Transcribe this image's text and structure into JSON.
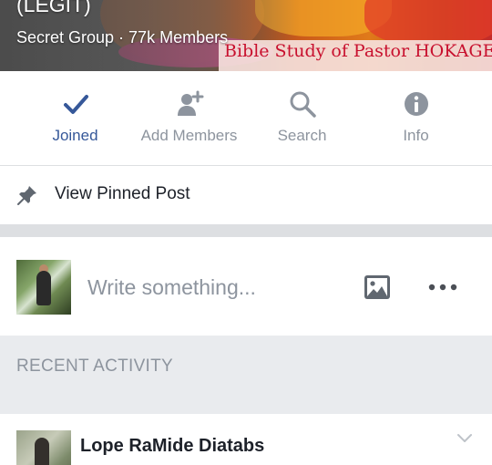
{
  "group": {
    "name": "(LEGIT)",
    "meta": "Secret Group · 77k Members",
    "cover_caption": "Bible Study of Pastor HOKAGE"
  },
  "actions": [
    {
      "label": "Joined",
      "icon": "checkmark-icon",
      "active": true
    },
    {
      "label": "Add Members",
      "icon": "add-person-icon",
      "active": false
    },
    {
      "label": "Search",
      "icon": "search-icon",
      "active": false
    },
    {
      "label": "Info",
      "icon": "info-icon",
      "active": false
    }
  ],
  "pinned": {
    "label": "View Pinned Post",
    "icon": "pin-icon"
  },
  "composer": {
    "placeholder": "Write something...",
    "photo_icon": "photo-icon",
    "more_icon": "more-dots-icon"
  },
  "recent_activity": {
    "header": "RECENT ACTIVITY",
    "items": [
      {
        "author": "Lope RaMide Diatabs"
      }
    ]
  },
  "colors": {
    "accent": "#365899",
    "icon_gray": "#8d949e",
    "text": "#1d2129",
    "divider": "#dddfe2",
    "section_bg": "#e9ebee",
    "cover_caption": "#c8102e"
  }
}
